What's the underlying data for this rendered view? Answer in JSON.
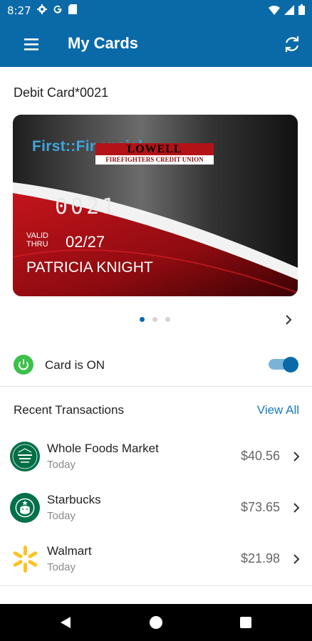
{
  "status_bar": {
    "time": "8:27",
    "left_icons": [
      "gear-icon",
      "google-icon",
      "sim-card-icon"
    ],
    "right_icons": [
      "wifi-icon",
      "signal-icon",
      "battery-icon"
    ]
  },
  "app_bar": {
    "title": "My Cards",
    "menu_icon": "hamburger-menu-icon",
    "refresh_icon": "refresh-icon",
    "background": "#0a6aa8"
  },
  "card_section": {
    "title": "Debit Card*0021",
    "card": {
      "logo_text": "First::Financial",
      "banner_top": "LOWELL",
      "banner_bottom": "FIREFIGHTERS CREDIT UNION",
      "number": "0021",
      "valid_label_line1": "VALID",
      "valid_label_line2": "THRU",
      "expiry": "02/27",
      "cardholder": "PATRICIA KNIGHT"
    },
    "pager": {
      "pages": 3,
      "active_index": 0
    }
  },
  "card_toggle": {
    "label": "Card is ON",
    "is_on": true,
    "icon": "power-icon",
    "accent": "#3cc14a"
  },
  "transactions": {
    "title": "Recent Transactions",
    "view_all": "View All",
    "items": [
      {
        "merchant": "Whole Foods Market",
        "date": "Today",
        "amount": "$40.56",
        "logo": "whole-foods-logo"
      },
      {
        "merchant": "Starbucks",
        "date": "Today",
        "amount": "$73.65",
        "logo": "starbucks-logo"
      },
      {
        "merchant": "Walmart",
        "date": "Today",
        "amount": "$21.98",
        "logo": "walmart-logo"
      }
    ]
  },
  "nav_bar": {
    "icons": [
      "back-icon",
      "home-icon",
      "recents-icon"
    ]
  }
}
